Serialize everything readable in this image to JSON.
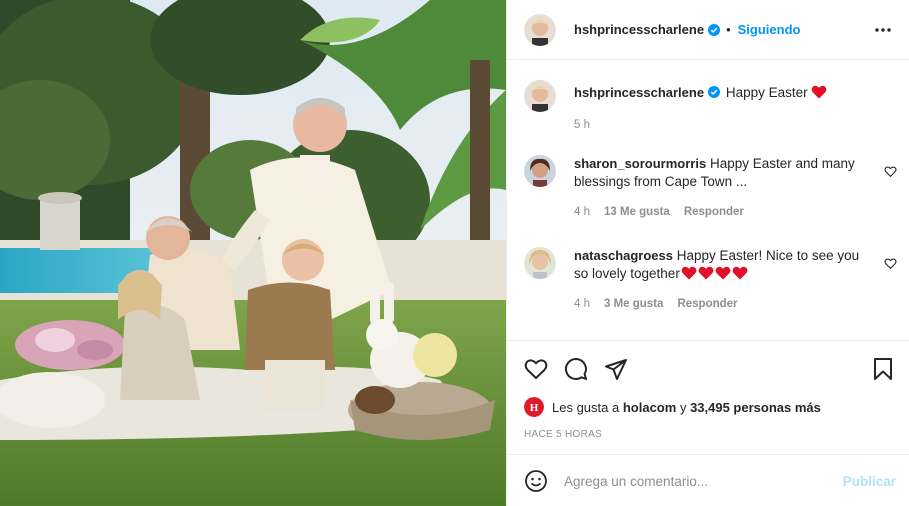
{
  "post": {
    "username": "hshprincesscharlene",
    "follow_label": "Siguiendo",
    "dot": "•",
    "caption_text": "Happy Easter",
    "caption_age": "5 h"
  },
  "comments": [
    {
      "username": "sharon_sorourmorris",
      "text": "Happy Easter and many blessings from Cape Town ...",
      "age": "4 h",
      "likes": "13 Me gusta",
      "reply": "Responder"
    },
    {
      "username": "nataschagroess",
      "text": "Happy Easter! Nice to see you so lovely together",
      "hearts": 4,
      "age": "4 h",
      "likes": "3 Me gusta",
      "reply": "Responder"
    }
  ],
  "likes": {
    "prefix": "Les gusta a",
    "first_user": "holacom",
    "connector": "y",
    "others": "33,495 personas más"
  },
  "timestamp": "HACE 5 HORAS",
  "composer": {
    "placeholder": "Agrega un comentario...",
    "publish_label": "Publicar"
  },
  "colors": {
    "accent": "#0095f6",
    "publish_disabled": "#b2dffc",
    "heart_emoji": "#e0102a",
    "muted": "#8e8e8e"
  },
  "icons": [
    "verified-badge-icon",
    "more-options-icon",
    "like-heart-icon",
    "comment-icon",
    "share-icon",
    "save-icon",
    "emoji-icon"
  ]
}
